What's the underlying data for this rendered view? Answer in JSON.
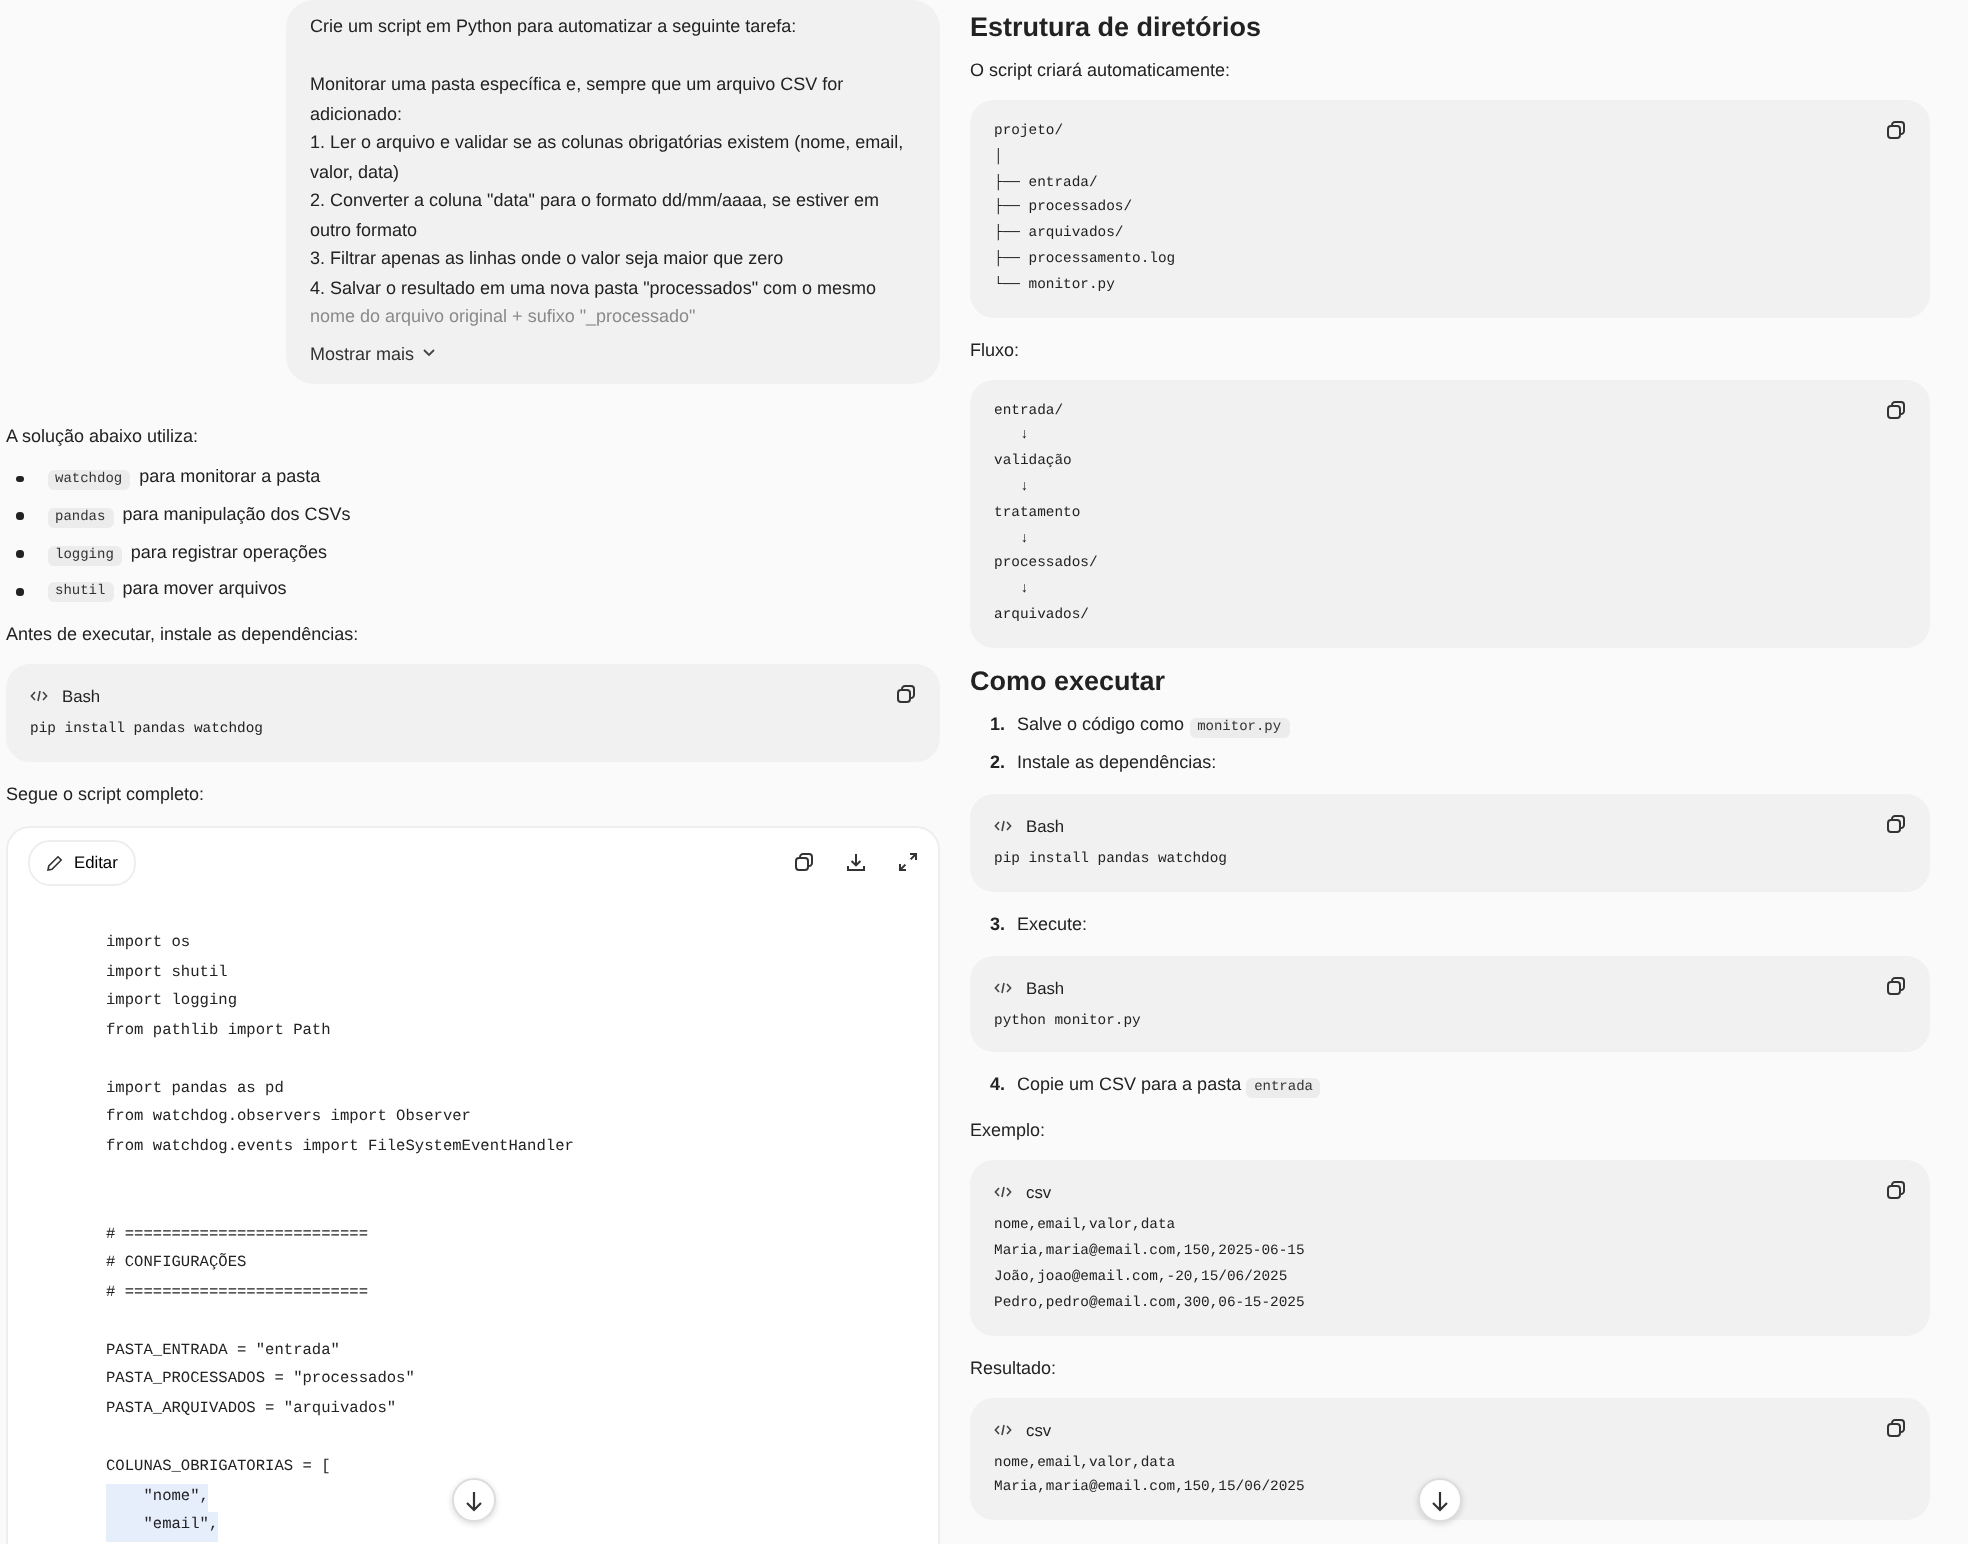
{
  "prompt": {
    "heading": "Crie um script em Python para automatizar a seguinte tarefa:",
    "lines": [
      {
        "text": "Monitorar uma pasta específica e, sempre que um arquivo CSV for adicionado:",
        "faded": false
      },
      {
        "text": "1. Ler o arquivo e validar se as colunas obrigatórias existem (nome, email, valor, data)",
        "faded": false
      },
      {
        "text": "2. Converter a coluna \"data\" para o formato dd/mm/aaaa, se estiver em outro formato",
        "faded": false
      },
      {
        "text": "3. Filtrar apenas as linhas onde o valor seja maior que zero",
        "faded": false
      },
      {
        "text": "4. Salvar o resultado em uma nova pasta \"processados\" com o mesmo",
        "faded": false
      },
      {
        "text": "nome do arquivo original + sufixo \"_processado\"",
        "faded": true
      }
    ],
    "show_more": "Mostrar mais"
  },
  "left": [
    {
      "kind": "text",
      "text": "A solução abaixo utiliza:"
    },
    {
      "kind": "bullet",
      "code": "watchdog",
      "text": "para monitorar a pasta"
    },
    {
      "kind": "bullet",
      "code": "pandas",
      "text": "para manipulação dos CSVs"
    },
    {
      "kind": "bullet",
      "code": "logging",
      "text": "para registrar operações"
    },
    {
      "kind": "bullet",
      "code": "shutil",
      "text": "para mover arquivos"
    },
    {
      "kind": "text",
      "text": "Antes de executar, instale as dependências:"
    },
    {
      "kind": "code",
      "language": "Bash",
      "lines": [
        "pip install pandas watchdog"
      ]
    },
    {
      "kind": "text",
      "text": "Segue o script completo:"
    },
    {
      "kind": "script",
      "edit_button": "Editar",
      "blocks": [
        {
          "wide_gap": false,
          "lines": [
            {
              "text": "import os",
              "highlighted": false
            },
            {
              "text": "import shutil",
              "highlighted": false
            },
            {
              "text": "import logging",
              "highlighted": false
            },
            {
              "text": "from pathlib import Path",
              "highlighted": false
            }
          ]
        },
        {
          "wide_gap": false,
          "lines": [
            {
              "text": "import pandas as pd",
              "highlighted": false
            },
            {
              "text": "from watchdog.observers import Observer",
              "highlighted": false
            },
            {
              "text": "from watchdog.events import FileSystemEventHandler",
              "highlighted": false
            }
          ]
        },
        {
          "wide_gap": true,
          "lines": [
            {
              "text": "# ==========================",
              "highlighted": false
            },
            {
              "text": "# CONFIGURAÇÕES",
              "highlighted": false
            },
            {
              "text": "# ==========================",
              "highlighted": false
            }
          ]
        },
        {
          "wide_gap": false,
          "lines": [
            {
              "text": "PASTA_ENTRADA = \"entrada\"",
              "highlighted": false
            },
            {
              "text": "PASTA_PROCESSADOS = \"processados\"",
              "highlighted": false
            },
            {
              "text": "PASTA_ARQUIVADOS = \"arquivados\"",
              "highlighted": false
            }
          ]
        },
        {
          "wide_gap": false,
          "lines": [
            {
              "text": "COLUNAS_OBRIGATORIAS = [",
              "highlighted": false
            },
            {
              "text": "    \"nome\",",
              "highlighted": true
            },
            {
              "text": "    \"email\",",
              "highlighted": true
            }
          ]
        }
      ]
    }
  ],
  "right": [
    {
      "kind": "heading",
      "text": "Estrutura de diretórios"
    },
    {
      "kind": "text",
      "text": "O script criará automaticamente:"
    },
    {
      "kind": "code",
      "lines": [
        "projeto/",
        "│",
        "├── entrada/",
        "├── processados/",
        "├── arquivados/",
        "├── processamento.log",
        "└── monitor.py"
      ]
    },
    {
      "kind": "text",
      "text": "Fluxo:"
    },
    {
      "kind": "code",
      "lines": [
        "entrada/",
        "   ↓",
        "validação",
        "   ↓",
        "tratamento",
        "   ↓",
        "processados/",
        "   ↓",
        "arquivados/"
      ]
    },
    {
      "kind": "heading",
      "text": "Como executar"
    },
    {
      "kind": "step",
      "number": "1.",
      "text": "Salve o código como",
      "code": "monitor.py"
    },
    {
      "kind": "step",
      "number": "2.",
      "text": "Instale as dependências:"
    },
    {
      "kind": "code",
      "language": "Bash",
      "lines": [
        "pip install pandas watchdog"
      ]
    },
    {
      "kind": "step",
      "number": "3.",
      "text": "Execute:"
    },
    {
      "kind": "code",
      "language": "Bash",
      "lines": [
        "python monitor.py"
      ]
    },
    {
      "kind": "step",
      "number": "4.",
      "text": "Copie um CSV para a pasta",
      "code": "entrada"
    },
    {
      "kind": "text",
      "text": "Exemplo:"
    },
    {
      "kind": "code",
      "language": "csv",
      "lines": [
        "nome,email,valor,data",
        "Maria,maria@email.com,150,2025-06-15",
        "João,joao@email.com,-20,15/06/2025",
        "Pedro,pedro@email.com,300,06-15-2025"
      ]
    },
    {
      "kind": "text",
      "text": "Resultado:"
    },
    {
      "kind": "code",
      "language": "csv",
      "lines": [
        "nome,email,valor,data",
        "Maria,maria@email.com,150,15/06/2025"
      ]
    }
  ]
}
